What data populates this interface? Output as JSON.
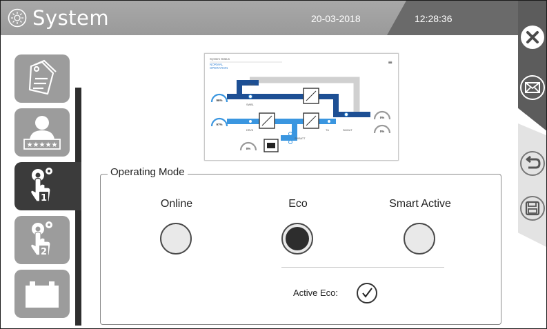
{
  "header": {
    "title": "System",
    "date": "20-03-2018",
    "time": "12:28:36"
  },
  "colors": {
    "header_bg": "#a0a0a0",
    "time_bg": "#6a6a6a",
    "nav_item": "#9c9c9c",
    "nav_active": "#3b3b3b",
    "right_panel_dark": "#5c5c5c",
    "right_panel_light": "#e3e3e3",
    "diagram_dark_blue": "#1d4f94",
    "diagram_light_blue": "#3a96e0",
    "diagram_gray": "#cfcfcf"
  },
  "nav": {
    "items": [
      {
        "name": "tags",
        "icon": "tag-icon",
        "active": false
      },
      {
        "name": "user-password",
        "icon": "user-password-icon",
        "active": false
      },
      {
        "name": "settings-1",
        "icon": "gear-hand-1-icon",
        "active": true,
        "number": "1"
      },
      {
        "name": "settings-2",
        "icon": "gear-hand-2-icon",
        "active": false,
        "number": "2"
      },
      {
        "name": "battery",
        "icon": "battery-icon",
        "active": false
      }
    ]
  },
  "right_panel": {
    "buttons": [
      {
        "name": "close-button",
        "icon": "close-icon"
      },
      {
        "name": "mail-button",
        "icon": "mail-icon"
      },
      {
        "name": "undo-button",
        "icon": "undo-icon"
      },
      {
        "name": "save-button",
        "icon": "save-icon"
      }
    ]
  },
  "diagram": {
    "status_label": "System Status",
    "status_value": "NORMAL OPERATION",
    "gauges": [
      {
        "pos": "left-top",
        "value": "96%"
      },
      {
        "pos": "left-mid",
        "value": "97%"
      },
      {
        "pos": "bottom",
        "value": "0%"
      },
      {
        "pos": "right-top",
        "value": "0%"
      },
      {
        "pos": "right-bottom",
        "value": "0%"
      }
    ],
    "labels": {
      "bypass": "DRV8",
      "main1": "SWB1",
      "main2": "DRV5",
      "tl": "TU",
      "smout": "SMOUT",
      "swbatt": "SWBATT"
    }
  },
  "operating_mode": {
    "title": "Operating Mode",
    "modes": [
      {
        "label": "Online",
        "selected": false
      },
      {
        "label": "Eco",
        "selected": true
      },
      {
        "label": "Smart Active",
        "selected": false
      }
    ],
    "active_eco_label": "Active Eco:",
    "active_eco_checked": true
  }
}
